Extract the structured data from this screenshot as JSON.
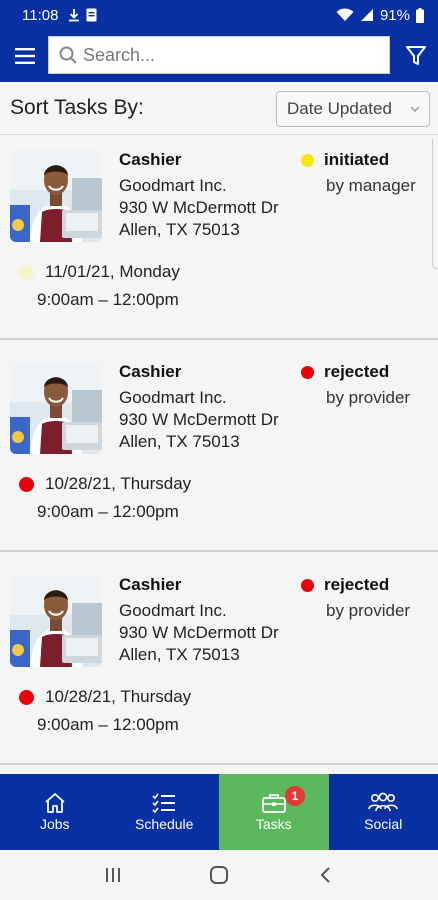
{
  "status_bar": {
    "time": "11:08",
    "battery": "91%"
  },
  "header": {
    "search_placeholder": "Search..."
  },
  "sort": {
    "label": "Sort Tasks By:",
    "selected": "Date Updated"
  },
  "tasks": [
    {
      "title": "Cashier",
      "company": "Goodmart Inc.",
      "address_line1": "930 W McDermott Dr",
      "address_line2": "Allen, TX 75013",
      "status": "initiated",
      "status_by": "by manager",
      "status_color": "#f5e90a",
      "date": "11/01/21, Monday",
      "date_dot_color": "#f7f3c8",
      "time": "9:00am – 12:00pm"
    },
    {
      "title": "Cashier",
      "company": "Goodmart Inc.",
      "address_line1": "930 W McDermott Dr",
      "address_line2": "Allen, TX 75013",
      "status": "rejected",
      "status_by": "by provider",
      "status_color": "#e8000b",
      "date": "10/28/21, Thursday",
      "date_dot_color": "#e8000b",
      "time": "9:00am – 12:00pm"
    },
    {
      "title": "Cashier",
      "company": "Goodmart Inc.",
      "address_line1": "930 W McDermott Dr",
      "address_line2": "Allen, TX 75013",
      "status": "rejected",
      "status_by": "by provider",
      "status_color": "#e8000b",
      "date": "10/28/21, Thursday",
      "date_dot_color": "#e8000b",
      "time": "9:00am – 12:00pm"
    }
  ],
  "bottom_nav": {
    "items": [
      {
        "label": "Jobs",
        "icon": "home-icon"
      },
      {
        "label": "Schedule",
        "icon": "checklist-icon"
      },
      {
        "label": "Tasks",
        "icon": "briefcase-icon",
        "badge": "1",
        "active": true
      },
      {
        "label": "Social",
        "icon": "people-icon"
      }
    ]
  },
  "colors": {
    "brand": "#0730a3",
    "active_tab": "#5cb85c",
    "badge": "#e53935"
  }
}
